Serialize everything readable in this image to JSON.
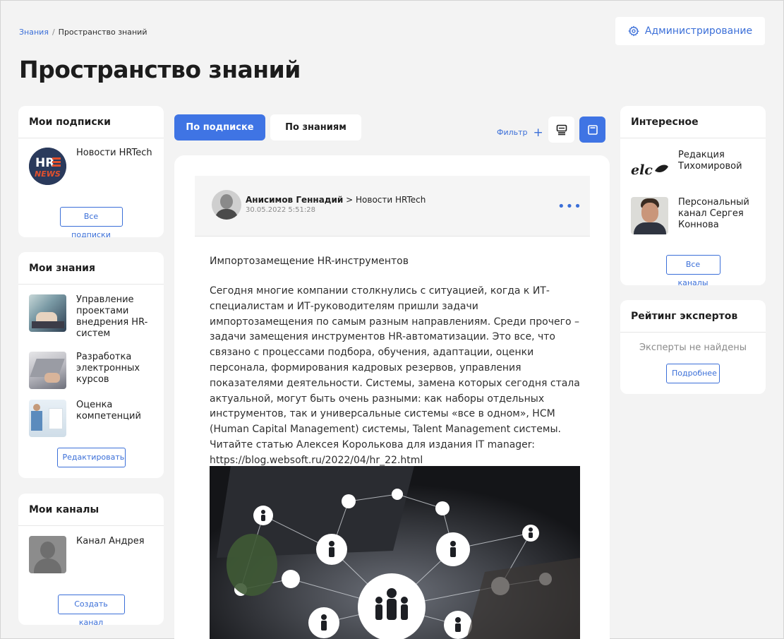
{
  "breadcrumb": {
    "root": "Знания",
    "current": "Пространство знаний"
  },
  "header": {
    "admin_label": "Администрирование",
    "title": "Пространство знаний"
  },
  "subscriptions": {
    "title": "Мои подписки",
    "items": [
      {
        "name": "Новости HRTech",
        "logo_text": "HR NEWS"
      }
    ],
    "all_label": "Все подписки"
  },
  "knowledge": {
    "title": "Мои знания",
    "items": [
      {
        "name": "Управление проектами внедрения HR-систем"
      },
      {
        "name": "Разработка электронных курсов"
      },
      {
        "name": "Оценка компетенций"
      }
    ],
    "edit_label": "Редактировать"
  },
  "channels": {
    "title": "Мои каналы",
    "items": [
      {
        "name": "Канал Андрея"
      }
    ],
    "create_label": "Создать канал"
  },
  "tabs": [
    {
      "label": "По подписке",
      "active": true
    },
    {
      "label": "По знаниям",
      "active": false
    }
  ],
  "filter": {
    "label": "Фильтр",
    "plus": "+"
  },
  "post": {
    "author": "Анисимов Геннадий",
    "separator": ">",
    "channel": "Новости HRTech",
    "date": "30.05.2022 5:51:28",
    "more": "•••",
    "title": "Импортозамещение HR-инструментов",
    "body": "Сегодня многие компании столкнулись с ситуацией, когда к ИТ-специалистам и ИТ-руководителям пришли задачи импортозамещения по самым разным направлениям. Среди прочего – задачи замещения инструментов HR-автоматизации. Это все, что связано с процессами подбора, обучения, адаптации, оценки персонала, формирования кадровых резервов, управления показателями деятельности. Системы, замена которых сегодня стала актуальной, могут быть очень разными: как наборы отдельных инструментов, так и универсальные системы «все в одном», HCM (Human Capital Management) системы, Talent Management системы. Читайте статью Алексея Королькова для издания IT manager: https://blog.websoft.ru/2022/04/hr_22.html"
  },
  "interesting": {
    "title": "Интересное",
    "items": [
      {
        "name": "Редакция Тихомировой",
        "logo_text": "elc"
      },
      {
        "name": "Персональный канал Сергея Коннова"
      }
    ],
    "all_label": "Все каналы"
  },
  "experts": {
    "title": "Рейтинг экспертов",
    "empty": "Эксперты не найдены",
    "more_label": "Подробнее"
  },
  "colors": {
    "accent": "#3f74e4",
    "link": "#3b6fd8",
    "background": "#f3f3f3"
  }
}
